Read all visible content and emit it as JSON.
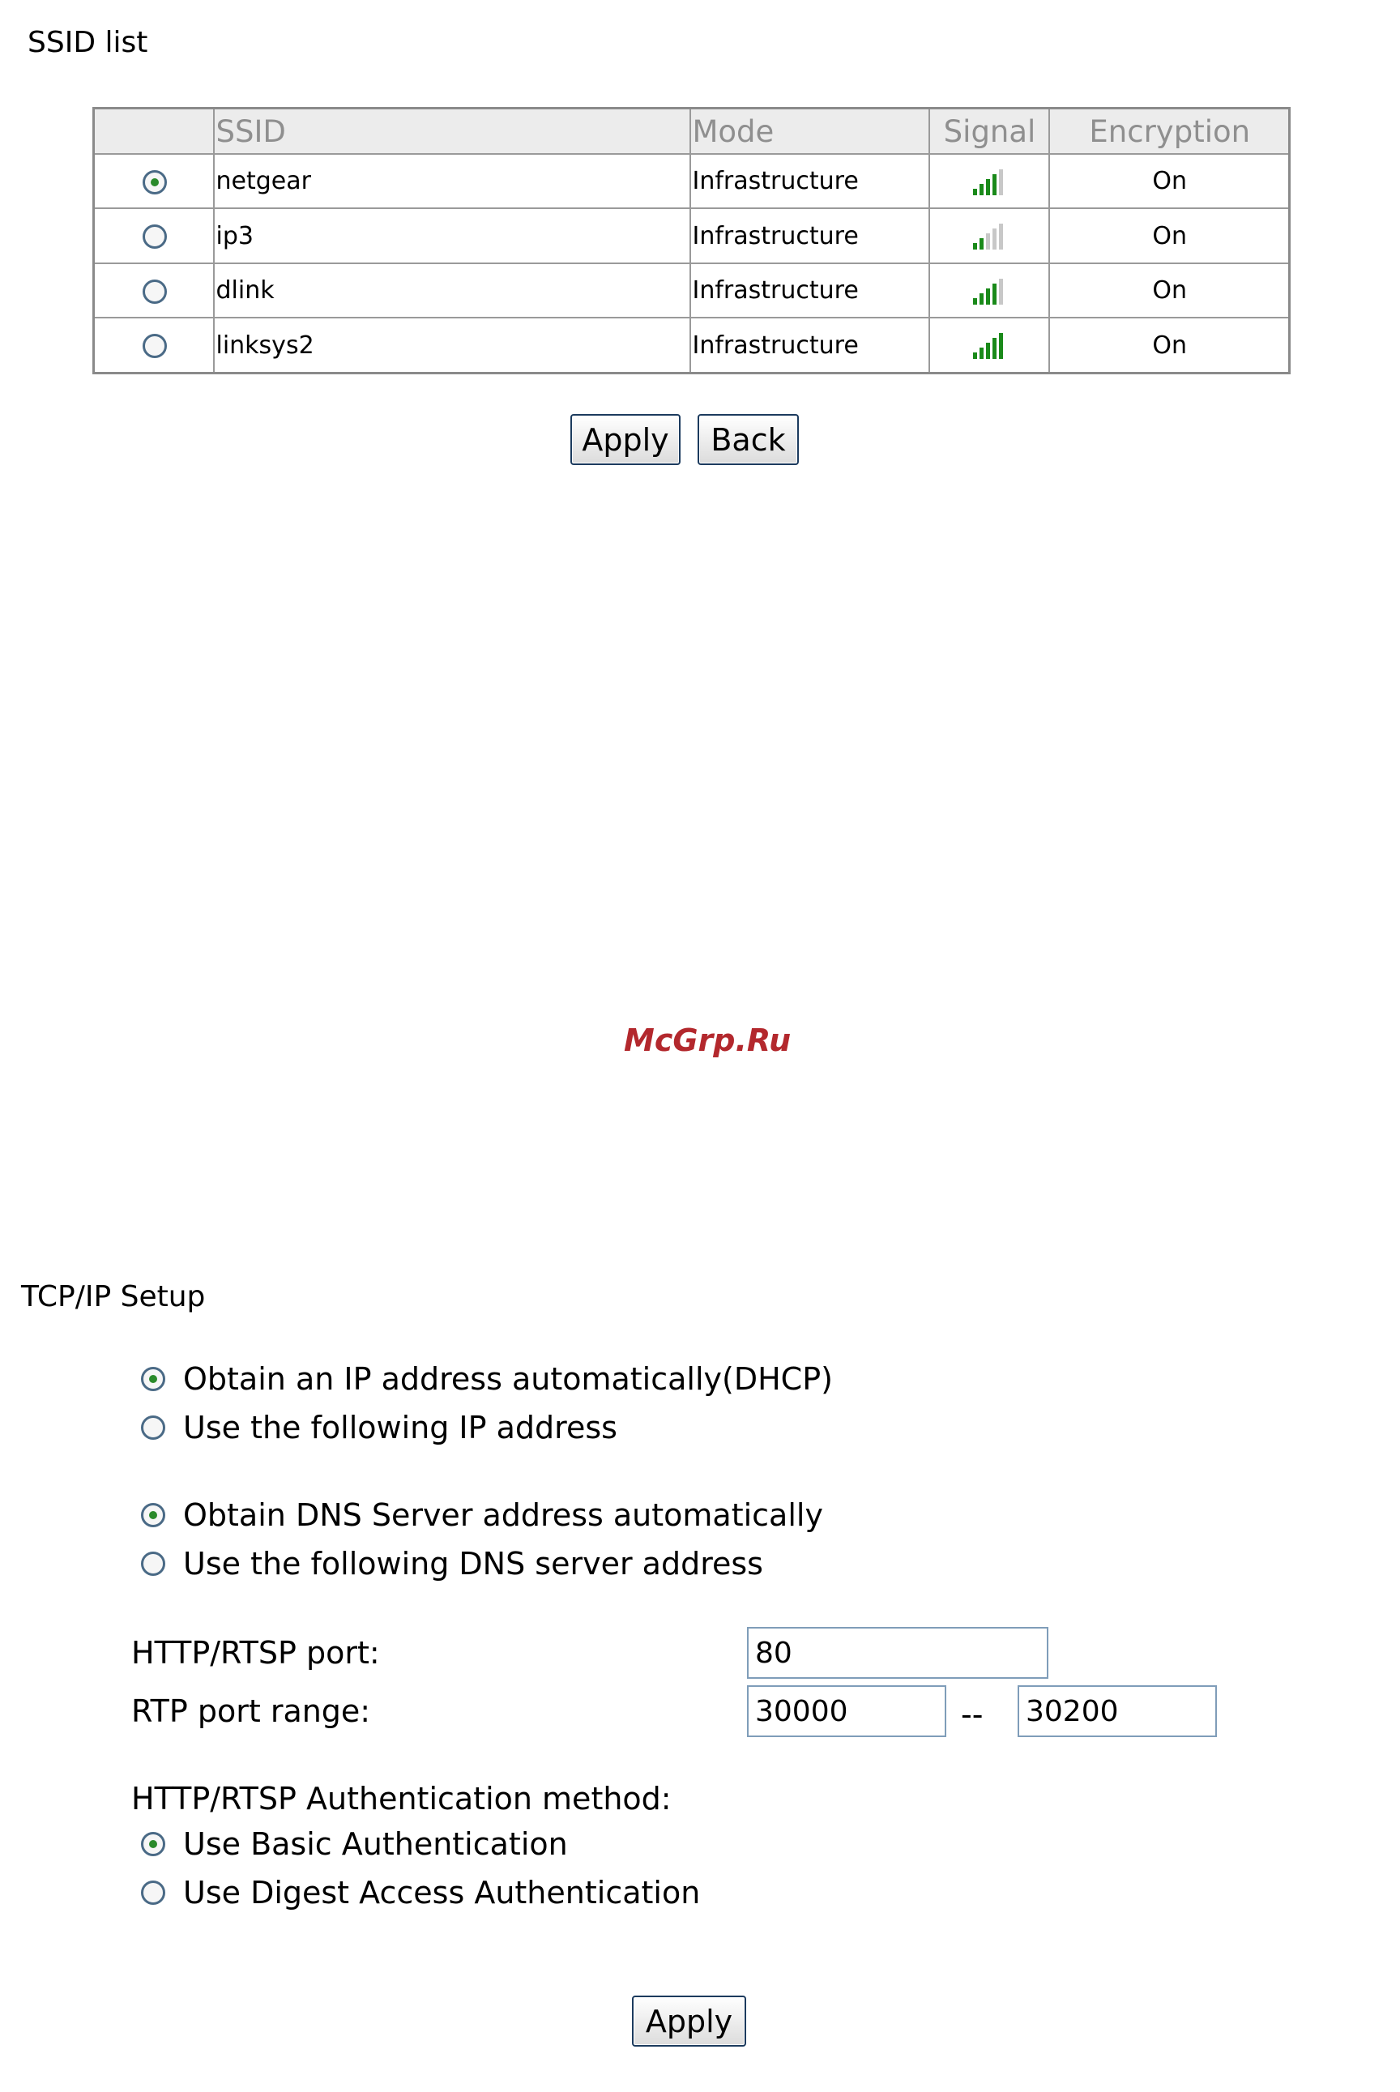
{
  "ssid_section": {
    "title": "SSID list",
    "columns": [
      "",
      "SSID",
      "Mode",
      "Signal",
      "Encryption"
    ],
    "rows": [
      {
        "selected": true,
        "ssid": "netgear",
        "mode": "Infrastructure",
        "signal_bars": 4,
        "encryption": "On"
      },
      {
        "selected": false,
        "ssid": "ip3",
        "mode": "Infrastructure",
        "signal_bars": 2,
        "encryption": "On"
      },
      {
        "selected": false,
        "ssid": "dlink",
        "mode": "Infrastructure",
        "signal_bars": 4,
        "encryption": "On"
      },
      {
        "selected": false,
        "ssid": "linksys2",
        "mode": "Infrastructure",
        "signal_bars": 5,
        "encryption": "On"
      }
    ],
    "signal_colors": {
      "active": "#1a8a1a",
      "inactive": "#c8c8c8"
    },
    "apply_label": "Apply",
    "back_label": "Back"
  },
  "watermark": "McGrp.Ru",
  "tcp_section": {
    "title": "TCP/IP Setup",
    "ip_options": [
      {
        "label": "Obtain an IP address automatically(DHCP)",
        "selected": true
      },
      {
        "label": "Use the following IP address",
        "selected": false
      }
    ],
    "dns_options": [
      {
        "label": "Obtain DNS Server address automatically",
        "selected": true
      },
      {
        "label": "Use the following DNS server address",
        "selected": false
      }
    ],
    "http_port_label": "HTTP/RTSP port:",
    "http_port_value": "80",
    "rtp_label": "RTP port range:",
    "rtp_start": "30000",
    "rtp_separator": "--",
    "rtp_end": "30200",
    "auth_label": "HTTP/RTSP Authentication method:",
    "auth_options": [
      {
        "label": "Use Basic Authentication",
        "selected": true
      },
      {
        "label": "Use Digest Access Authentication",
        "selected": false
      }
    ],
    "apply_label": "Apply"
  }
}
